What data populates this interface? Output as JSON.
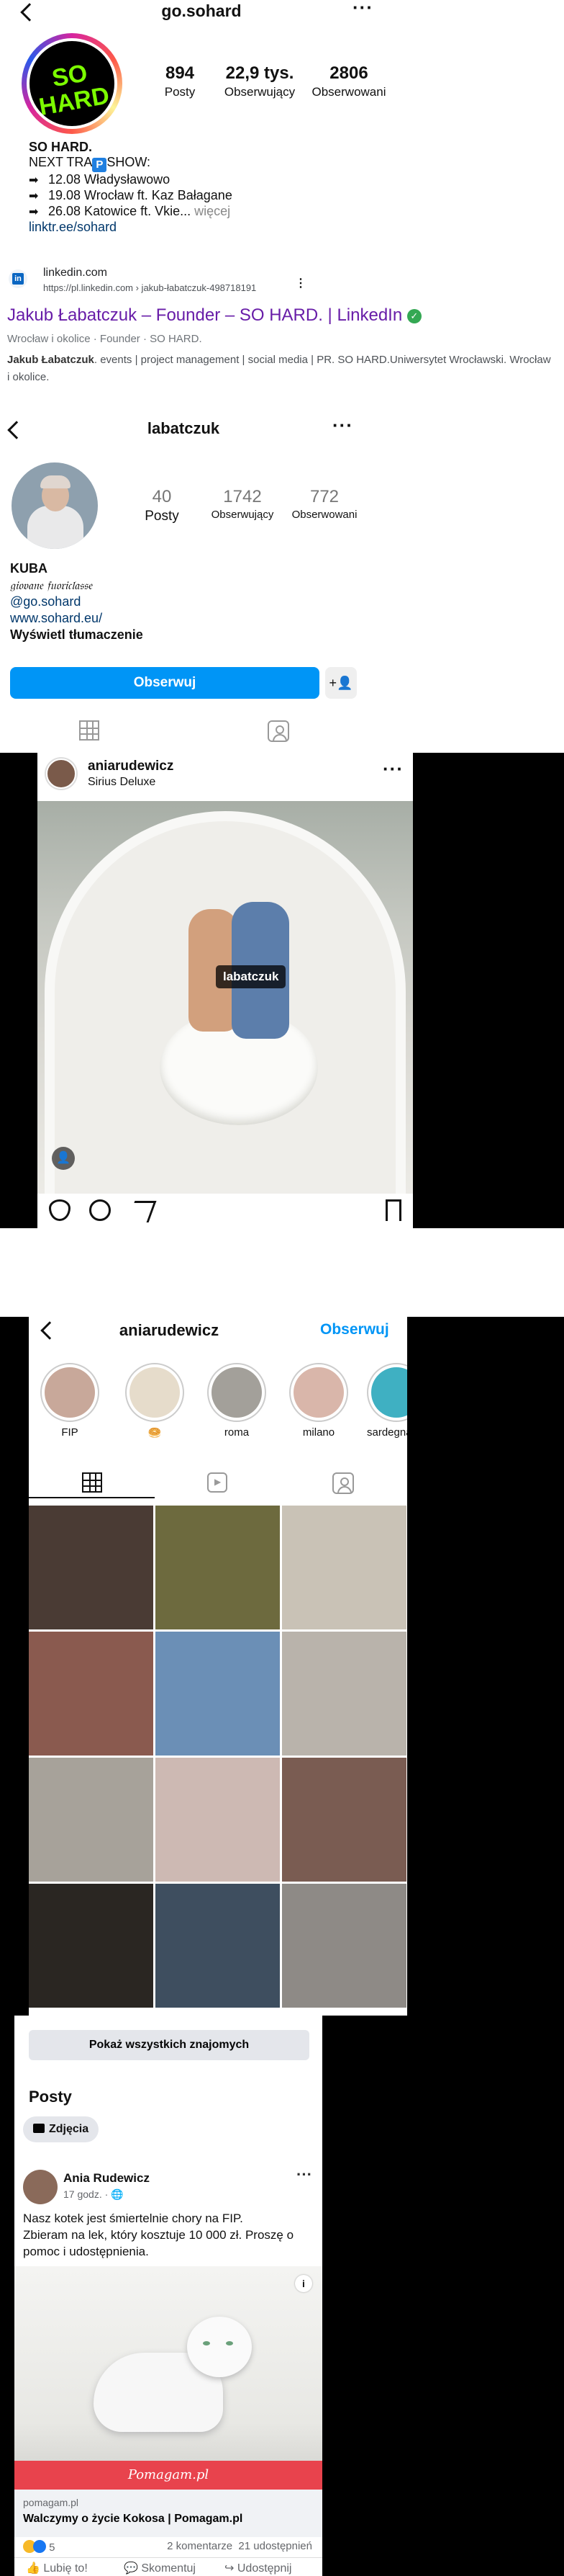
{
  "section1": {
    "username": "go.sohard",
    "avatar_text": "SO HARD",
    "stats": [
      {
        "value": "894",
        "label": "Posty"
      },
      {
        "value": "22,9 tys.",
        "label": "Obserwujący"
      },
      {
        "value": "2806",
        "label": "Obserwowani"
      }
    ],
    "bio": {
      "name": "SO HARD.",
      "line1_a": "NEXT TRA",
      "line1_p": "P",
      "line1_b": "SHOW:",
      "events": [
        "12.08 Władysławowo",
        "19.08 Wrocław ft. Kaz Bałagane",
        "26.08 Katowice ft. Vkie..."
      ],
      "more": "więcej",
      "link": "linktr.ee/sohard"
    }
  },
  "section2": {
    "site": "linkedin.com",
    "url": "https://pl.linkedin.com › jakub-łabatczuk-498718191",
    "title": "Jakub Łabatczuk – Founder – SO HARD. | LinkedIn",
    "meta": "Wrocław i okolice · Founder · SO HARD.",
    "snippet_bold": "Jakub Łabatczuk",
    "snippet": ". events | project management | social media | PR. SO HARD.Uniwersytet Wrocławski. Wrocław i okolice."
  },
  "section3": {
    "username": "labatczuk",
    "stats": [
      {
        "value": "40",
        "label": "Posty"
      },
      {
        "value": "1742",
        "label": "Obserwujący"
      },
      {
        "value": "772",
        "label": "Obserwowani"
      }
    ],
    "bio": {
      "name": "KUBA",
      "script": "𝔤𝔦𝔬𝔳𝔞𝔫𝔢 𝔣𝔲𝔬𝔯𝔦𝔠𝔩𝔞𝔰𝔰𝔢",
      "mention": "@go.sohard",
      "website": "www.sohard.eu/",
      "translate": "Wyświetl tłumaczenie"
    },
    "follow_label": "Obserwuj"
  },
  "section4": {
    "author": "aniarudewicz",
    "location": "Sirius Deluxe",
    "tag": "labatczuk"
  },
  "section5": {
    "username": "aniarudewicz",
    "follow_label": "Obserwuj",
    "highlights": [
      {
        "label": "FIP",
        "color": "#c8a89a"
      },
      {
        "label": "🥯",
        "color": "#e6dccb"
      },
      {
        "label": "roma",
        "color": "#a3a09a"
      },
      {
        "label": "milano",
        "color": "#d9b6aa"
      },
      {
        "label": "sardegna",
        "color": "#3fb0c2"
      }
    ],
    "grid_colors": [
      "#4a3b34",
      "#6d6a3e",
      "#c9c2b6",
      "#8a5a4f",
      "#6b8fb6",
      "#b9b3ab",
      "#a7a29a",
      "#cdb9b3",
      "#7a5c52",
      "#2a2622",
      "#3e4e5f",
      "#8e8a86"
    ]
  },
  "section6": {
    "all_friends": "Pokaż wszystkich znajomych",
    "posts_heading": "Posty",
    "photos_chip": "Zdjęcia",
    "author": "Ania Rudewicz",
    "time": "17 godz. · 🌐",
    "text_1": "Nasz kotek jest śmiertelnie chory na FIP.",
    "text_2": "Zbieram na lek, który kosztuje 10 000 zł. Proszę o pomoc i udostępnienia.",
    "brand": "Pomagam.pl",
    "link_domain": "pomagam.pl",
    "link_title": "Walczymy o życie Kokosa | Pomagam.pl",
    "reactions": "5",
    "comments": "2 komentarze",
    "shares": "21 udostępnień",
    "like": "Lubię to!",
    "comment": "Skomentuj",
    "share": "Udostępnij"
  }
}
